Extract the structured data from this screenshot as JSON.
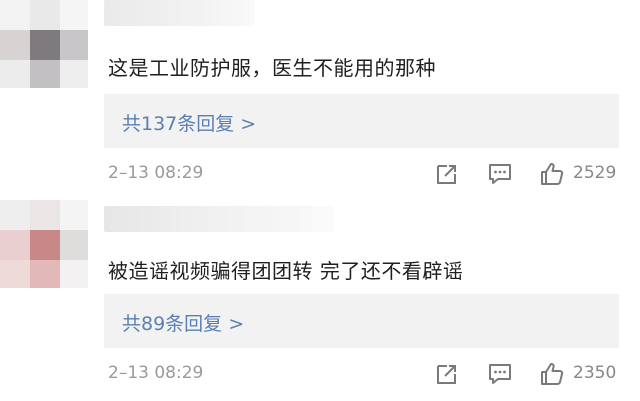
{
  "comments": [
    {
      "text": "这是工业防护服，医生不能用的那种",
      "replies_label": "共137条回复 >",
      "time": "2–13 08:29",
      "likes": "2529"
    },
    {
      "text": "被造谣视频骗得团团转 完了还不看辟谣",
      "replies_label": "共89条回复 >",
      "time": "2–13 08:29",
      "likes": "2350"
    }
  ],
  "icons": {
    "share": "share-icon",
    "reply": "comment-icon",
    "like": "thumbs-up-icon"
  },
  "colors": {
    "link": "#5b7fb3",
    "reply_box": "#f2f2f2",
    "meta": "#9a9a9a"
  }
}
